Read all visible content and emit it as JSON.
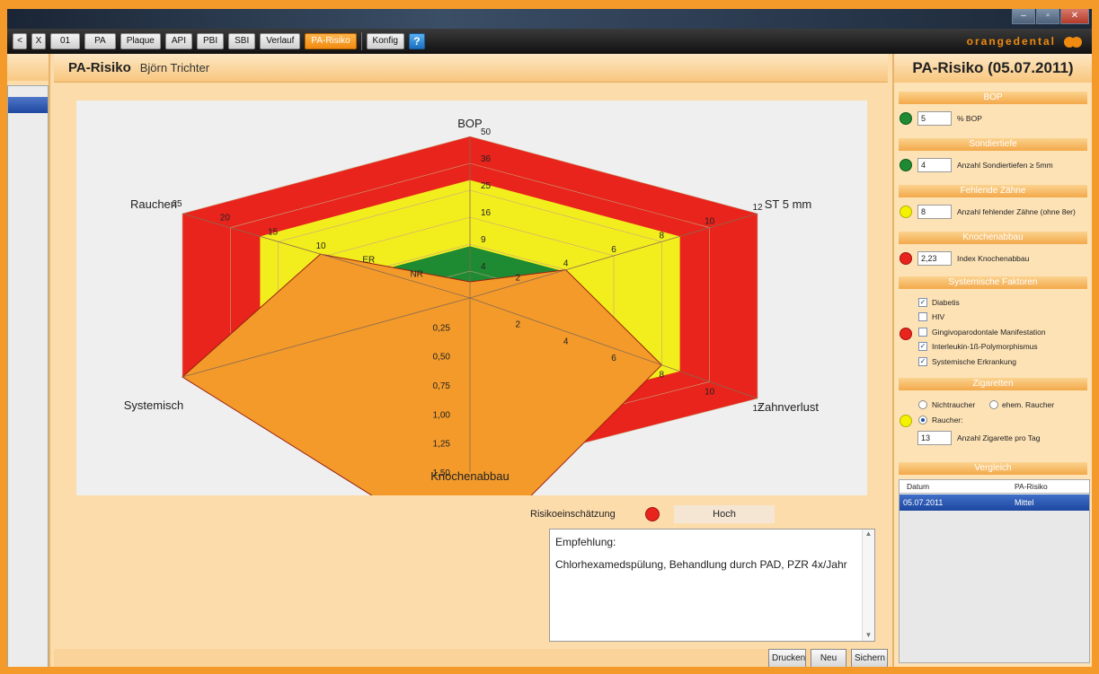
{
  "window": {
    "min": "‒",
    "max": "▫",
    "close": "✕"
  },
  "toolbar": {
    "nav_back": "<",
    "close": "X",
    "buttons": [
      "01",
      "PA",
      "Plaque",
      "API",
      "PBI",
      "SBI",
      "Verlauf",
      "PA-Risiko"
    ],
    "active": "PA-Risiko",
    "konfig": "Konfig",
    "help": "?",
    "brand": "orangedental"
  },
  "main": {
    "title": "PA-Risiko",
    "patient": "Björn Trichter",
    "risk_label": "Risikoeinschätzung",
    "risk_value": "Hoch",
    "recommendation_title": "Empfehlung:",
    "recommendation_text": "Chlorhexamedspülung, Behandlung durch PAD, PZR 4x/Jahr",
    "footer_buttons": [
      "Drucken",
      "Neu",
      "Sichern"
    ]
  },
  "chart_data": {
    "type": "radar",
    "axes": [
      {
        "name": "BOP",
        "ticks": [
          "4",
          "9",
          "16",
          "25",
          "36",
          "50"
        ],
        "value": 5
      },
      {
        "name": "ST 5 mm",
        "ticks": [
          "2",
          "4",
          "6",
          "8",
          "10",
          "12"
        ],
        "value": 4
      },
      {
        "name": "Zahnverlust",
        "ticks": [
          "2",
          "4",
          "6",
          "8",
          "10",
          "12"
        ],
        "value": 8
      },
      {
        "name": "Knochenabbau",
        "ticks": [
          "0,25",
          "0,50",
          "0,75",
          "1,00",
          "1,25",
          "1,50"
        ],
        "value": 2.23
      },
      {
        "name": "Systemisch",
        "ticks": [],
        "value": 1.0
      },
      {
        "name": "Rauchen",
        "ticks": [
          "NR",
          "ER",
          "10",
          "15",
          "20",
          "25"
        ],
        "value": 13
      }
    ],
    "zones": [
      {
        "level": "green",
        "color": "#1e8a32"
      },
      {
        "level": "yellow",
        "color": "#f2ee1e"
      },
      {
        "level": "red",
        "color": "#e8241c"
      }
    ],
    "patient_color": "#f39a2b"
  },
  "right": {
    "title": "PA-Risiko (05.07.2011)",
    "bop": {
      "section": "BOP",
      "value": "5",
      "label": "% BOP",
      "status": "green"
    },
    "sondier": {
      "section": "Sondiertiefe",
      "value": "4",
      "label": "Anzahl Sondiertiefen ≥ 5mm",
      "status": "green"
    },
    "zaehne": {
      "section": "Fehlende Zähne",
      "value": "8",
      "label": "Anzahl fehlender Zähne (ohne 8er)",
      "status": "yellow"
    },
    "knochen": {
      "section": "Knochenabbau",
      "value": "2,23",
      "label": "Index Knochenabbau",
      "status": "red"
    },
    "systemisch": {
      "section": "Systemische Faktoren",
      "status": "red",
      "items": [
        {
          "label": "Diabetis",
          "checked": true
        },
        {
          "label": "HIV",
          "checked": false
        },
        {
          "label": "Gingivoparodontale Manifestation",
          "checked": false
        },
        {
          "label": "Interleukin-1ß-Polymorphismus",
          "checked": true
        },
        {
          "label": "Systemische Erkrankung",
          "checked": true
        }
      ]
    },
    "zigaretten": {
      "section": "Zigaretten",
      "status": "yellow",
      "opt1": "Nichtraucher",
      "opt2": "ehem. Raucher",
      "opt3": "Raucher:",
      "value": "13",
      "label": "Anzahl Zigarette pro Tag"
    },
    "vergleich": {
      "section": "Vergleich",
      "col1": "Datum",
      "col2": "PA-Risiko",
      "row_date": "05.07.2011",
      "row_risk": "Mittel"
    }
  }
}
